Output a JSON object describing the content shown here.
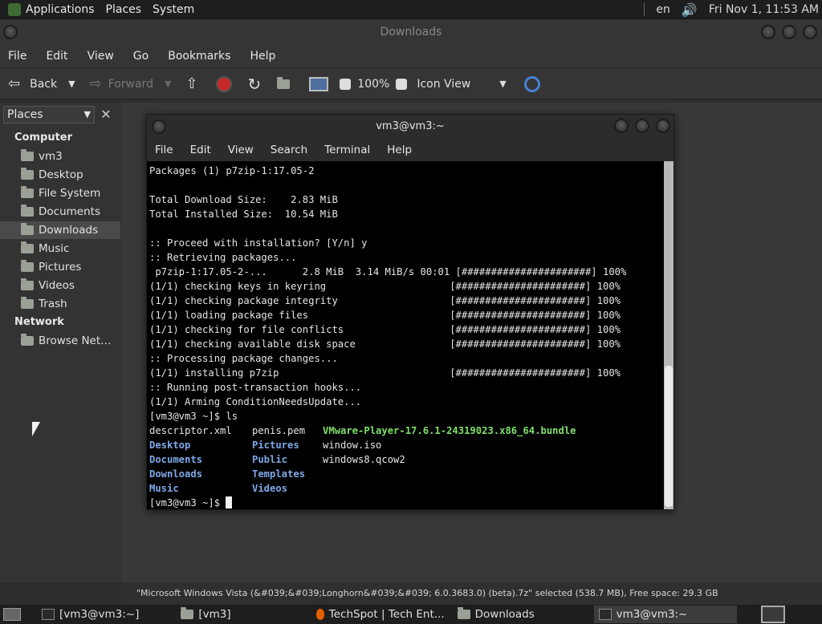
{
  "top_panel": {
    "menus": [
      "Applications",
      "Places",
      "System"
    ],
    "keyboard": "en",
    "clock": "Fri Nov 1, 11:53 AM"
  },
  "file_manager": {
    "title": "Downloads",
    "menu": [
      "File",
      "Edit",
      "View",
      "Go",
      "Bookmarks",
      "Help"
    ],
    "toolbar": {
      "back": "Back",
      "forward": "Forward",
      "zoom": "100%",
      "view_mode": "Icon View"
    },
    "sidebar": {
      "selector": "Places",
      "sections": [
        {
          "title": "Computer",
          "items": [
            "vm3",
            "Desktop",
            "File System",
            "Documents",
            "Downloads",
            "Music",
            "Pictures",
            "Videos",
            "Trash"
          ]
        },
        {
          "title": "Network",
          "items": [
            "Browse Net…"
          ]
        }
      ],
      "selected": "Downloads"
    },
    "status": "\"Microsoft Windows Vista (&#039;&#039;Longhorn&#039;&#039; 6.0.3683.0) (beta).7z\" selected (538.7 MB), Free space: 29.3 GB"
  },
  "terminal": {
    "title": "vm3@vm3:~",
    "menu": [
      "File",
      "Edit",
      "View",
      "Search",
      "Terminal",
      "Help"
    ],
    "lines": [
      "Packages (1) p7zip-1:17.05-2",
      "",
      "Total Download Size:    2.83 MiB",
      "Total Installed Size:  10.54 MiB",
      "",
      ":: Proceed with installation? [Y/n] y",
      ":: Retrieving packages...",
      " p7zip-1:17.05-2-...      2.8 MiB  3.14 MiB/s 00:01 [######################] 100%",
      "(1/1) checking keys in keyring                     [######################] 100%",
      "(1/1) checking package integrity                   [######################] 100%",
      "(1/1) loading package files                        [######################] 100%",
      "(1/1) checking for file conflicts                  [######################] 100%",
      "(1/1) checking available disk space                [######################] 100%",
      ":: Processing package changes...",
      "(1/1) installing p7zip                             [######################] 100%",
      ":: Running post-transaction hooks...",
      "(1/1) Arming ConditionNeedsUpdate...",
      "[vm3@vm3 ~]$ ls"
    ],
    "ls": {
      "row1": {
        "a": "descriptor.xml",
        "b": "penis.pem",
        "c": "VMware-Player-17.6.1-24319023.x86_64.bundle"
      },
      "row2": {
        "a": "Desktop",
        "b": "Pictures",
        "c": "window.iso"
      },
      "row3": {
        "a": "Documents",
        "b": "Public",
        "c": "windows8.qcow2"
      },
      "row4": {
        "a": "Downloads",
        "b": "Templates"
      },
      "row5": {
        "a": "Music",
        "b": "Videos"
      }
    },
    "prompt": "[vm3@vm3 ~]$ ",
    "scroll_position": 0.59
  },
  "taskbar": {
    "tasks": [
      "[vm3@vm3:~]",
      "[vm3]",
      "TechSpot | Tech Ent...",
      "Downloads",
      "vm3@vm3:~"
    ],
    "active": "vm3@vm3:~"
  }
}
